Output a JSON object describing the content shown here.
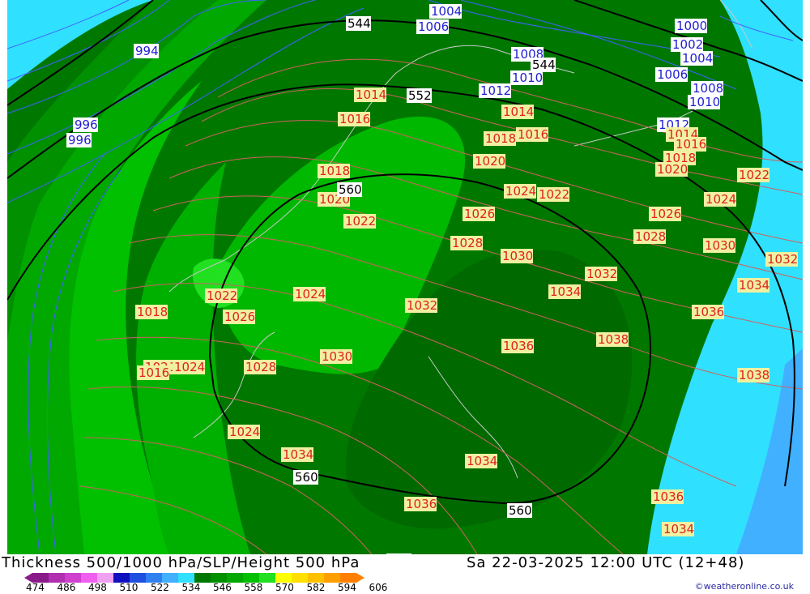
{
  "map": {
    "pressure_labels_blue": [
      "1004",
      "1006",
      "994",
      "996",
      "996",
      "1000",
      "1002",
      "1004",
      "1006",
      "1008",
      "1010",
      "1008",
      "1010",
      "1012",
      "1012"
    ],
    "pressure_labels_red": [
      "1014",
      "1016",
      "1018",
      "1020",
      "1022",
      "1024",
      "1026",
      "1028",
      "1030",
      "1032",
      "1034",
      "1036",
      "1038",
      "1014",
      "1016",
      "1018",
      "1020",
      "1022",
      "1024",
      "1026",
      "1028",
      "1030",
      "1032",
      "1034",
      "1036",
      "1038",
      "1014",
      "1016",
      "1018",
      "1020",
      "1022",
      "1024",
      "1026",
      "1028",
      "1030",
      "1032",
      "1034",
      "1036",
      "1034",
      "1036",
      "1038",
      "1034"
    ],
    "height_labels": [
      "544",
      "544",
      "552",
      "560",
      "560",
      "560",
      "552"
    ]
  },
  "footer": {
    "title": "Thickness 500/1000 hPa/SLP/Height 500 hPa",
    "datetime": "Sa 22-03-2025 12:00 UTC (12+48)",
    "credit": "©weatheronline.co.uk"
  },
  "colorbar": {
    "ticks": [
      "474",
      "486",
      "498",
      "510",
      "522",
      "534",
      "546",
      "558",
      "570",
      "582",
      "594",
      "606"
    ],
    "colors": [
      "#8a1a8a",
      "#b030b0",
      "#d040d0",
      "#f060f0",
      "#f0a0f0",
      "#1010c0",
      "#2050e0",
      "#3080f0",
      "#40b0ff",
      "#30e0ff",
      "#007800",
      "#009000",
      "#00a800",
      "#00c000",
      "#20e020",
      "#ffff00",
      "#ffe000",
      "#ffc000",
      "#ffa000",
      "#ff8000"
    ]
  },
  "labels": {
    "blue": [
      {
        "t": "1004"
      },
      {
        "t": "1006"
      },
      {
        "t": "994"
      },
      {
        "t": "996"
      },
      {
        "t": "996"
      },
      {
        "t": "1000"
      },
      {
        "t": "1002"
      },
      {
        "t": "1004"
      },
      {
        "t": "1006"
      },
      {
        "t": "1008"
      },
      {
        "t": "1010"
      },
      {
        "t": "1008"
      },
      {
        "t": "1010"
      },
      {
        "t": "1012"
      },
      {
        "t": "1012"
      }
    ],
    "red": [
      {
        "t": "1014"
      },
      {
        "t": "1016"
      },
      {
        "t": "1018"
      },
      {
        "t": "1020"
      },
      {
        "t": "1022"
      },
      {
        "t": "1024"
      },
      {
        "t": "1014"
      },
      {
        "t": "1016"
      },
      {
        "t": "1018"
      },
      {
        "t": "1020"
      },
      {
        "t": "1022"
      },
      {
        "t": "1024"
      },
      {
        "t": "1026"
      },
      {
        "t": "1028"
      },
      {
        "t": "1030"
      },
      {
        "t": "1014"
      },
      {
        "t": "1016"
      },
      {
        "t": "1018"
      },
      {
        "t": "1020"
      },
      {
        "t": "1022"
      },
      {
        "t": "1024"
      },
      {
        "t": "1026"
      },
      {
        "t": "1028"
      },
      {
        "t": "1030"
      },
      {
        "t": "1032"
      },
      {
        "t": "1034"
      },
      {
        "t": "1036"
      },
      {
        "t": "1038"
      },
      {
        "t": "1032"
      },
      {
        "t": "1034"
      },
      {
        "t": "1036"
      },
      {
        "t": "1038"
      },
      {
        "t": "1022"
      },
      {
        "t": "1024"
      },
      {
        "t": "1026"
      },
      {
        "t": "1028"
      },
      {
        "t": "1030"
      },
      {
        "t": "1032"
      },
      {
        "t": "1034"
      },
      {
        "t": "1036"
      },
      {
        "t": "1034"
      },
      {
        "t": "1036"
      },
      {
        "t": "1038"
      },
      {
        "t": "1034"
      },
      {
        "t": "1024"
      },
      {
        "t": "1018"
      },
      {
        "t": "1016"
      },
      {
        "t": "1024"
      },
      {
        "t": "1022"
      },
      {
        "t": "1026"
      },
      {
        "t": "1028"
      },
      {
        "t": "1030"
      },
      {
        "t": "1032"
      },
      {
        "t": "1036"
      }
    ],
    "height": [
      {
        "t": "544"
      },
      {
        "t": "544"
      },
      {
        "t": "552"
      },
      {
        "t": "560"
      },
      {
        "t": "560"
      },
      {
        "t": "560"
      },
      {
        "t": "552"
      }
    ]
  }
}
